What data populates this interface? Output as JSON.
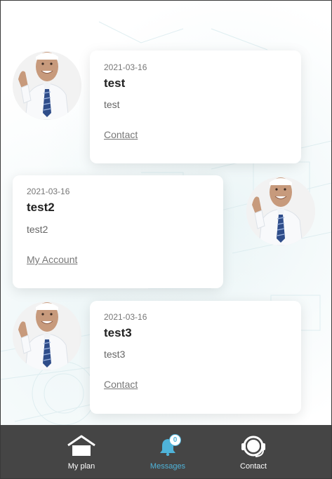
{
  "messages": [
    {
      "date": "2021-03-16",
      "title": "test",
      "body": "test",
      "link": "Contact"
    },
    {
      "date": "2021-03-16",
      "title": "test2",
      "body": "test2",
      "link": "My Account"
    },
    {
      "date": "2021-03-16",
      "title": "test3",
      "body": "test3",
      "link": "Contact"
    }
  ],
  "tabbar": {
    "items": [
      {
        "label": "My plan",
        "icon": "home-icon"
      },
      {
        "label": "Messages",
        "icon": "bell-icon",
        "badge": "0"
      },
      {
        "label": "Contact",
        "icon": "headset-icon"
      }
    ],
    "active": "Messages"
  },
  "colors": {
    "accent": "#4fb3d9",
    "tabbar_bg": "#454545"
  }
}
